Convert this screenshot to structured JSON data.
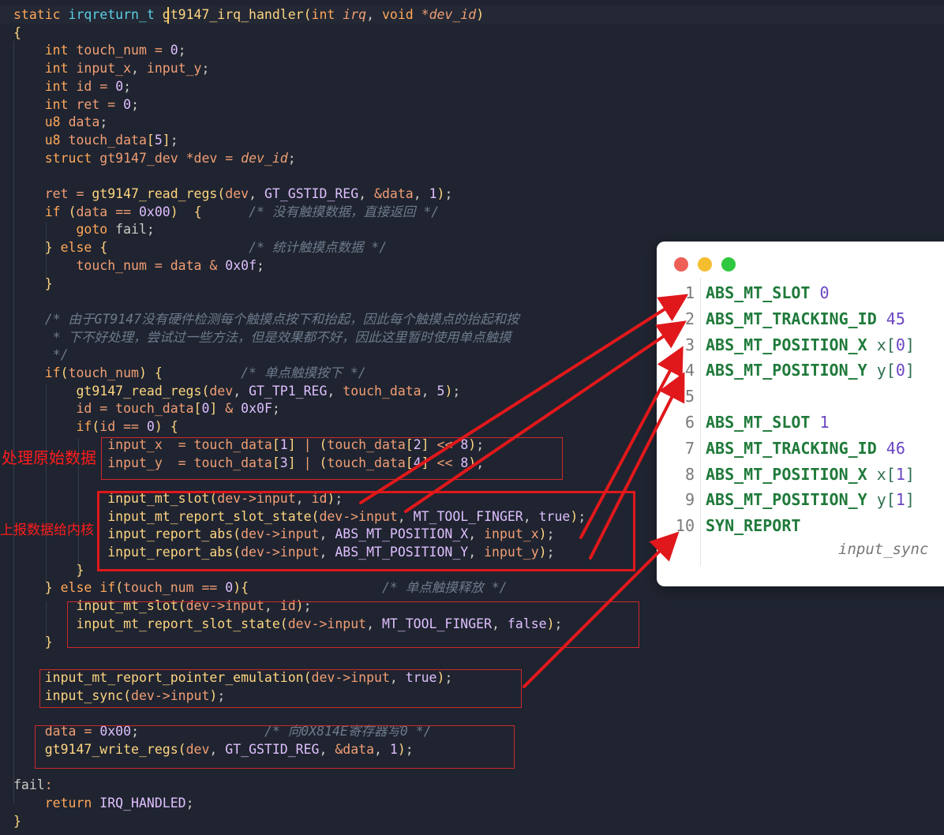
{
  "code": [
    "static irqreturn_t gt9147_irq_handler(int irq, void *dev_id)",
    "{",
    "    int touch_num = 0;",
    "    int input_x, input_y;",
    "    int id = 0;",
    "    int ret = 0;",
    "    u8 data;",
    "    u8 touch_data[5];",
    "    struct gt9147_dev *dev = dev_id;",
    "",
    "    ret = gt9147_read_regs(dev, GT_GSTID_REG, &data, 1);",
    "    if (data == 0x00)  {      /* 没有触摸数据，直接返回 */",
    "        goto fail;",
    "    } else {                  /* 统计触摸点数据 */",
    "        touch_num = data & 0x0f;",
    "    }",
    "",
    "    /* 由于GT9147没有硬件检测每个触摸点按下和抬起，因此每个触摸点的抬起和按",
    "     * 下不好处理，尝试过一些方法，但是效果都不好，因此这里暂时使用单点触摸",
    "     */",
    "    if(touch_num) {          /* 单点触摸按下 */",
    "        gt9147_read_regs(dev, GT_TP1_REG, touch_data, 5);",
    "        id = touch_data[0] & 0x0F;",
    "        if(id == 0) {",
    "            input_x  = touch_data[1] | (touch_data[2] << 8);",
    "            input_y  = touch_data[3] | (touch_data[4] << 8);",
    "",
    "            input_mt_slot(dev->input, id);",
    "            input_mt_report_slot_state(dev->input, MT_TOOL_FINGER, true);",
    "            input_report_abs(dev->input, ABS_MT_POSITION_X, input_x);",
    "            input_report_abs(dev->input, ABS_MT_POSITION_Y, input_y);",
    "        }",
    "    } else if(touch_num == 0){                 /* 单点触摸释放 */",
    "        input_mt_slot(dev->input, id);",
    "        input_mt_report_slot_state(dev->input, MT_TOOL_FINGER, false);",
    "    }",
    "",
    "    input_mt_report_pointer_emulation(dev->input, true);",
    "    input_sync(dev->input);",
    "",
    "    data = 0x00;                /* 向0X814E寄存器写0 */",
    "    gt9147_write_regs(dev, GT_GSTID_REG, &data, 1);",
    "",
    "fail:",
    "    return IRQ_HANDLED;",
    "}"
  ],
  "annotations": {
    "raw_data": "处理原始数据",
    "report_kernel": "上报数据给内核"
  },
  "card": {
    "lines": [
      {
        "no": "1",
        "text": "ABS_MT_SLOT 0"
      },
      {
        "no": "2",
        "text": "ABS_MT_TRACKING_ID 45"
      },
      {
        "no": "3",
        "text": "ABS_MT_POSITION_X x[0]"
      },
      {
        "no": "4",
        "text": "ABS_MT_POSITION_Y y[0]"
      },
      {
        "no": "5",
        "text": ""
      },
      {
        "no": "6",
        "text": "ABS_MT_SLOT 1"
      },
      {
        "no": "7",
        "text": "ABS_MT_TRACKING_ID 46"
      },
      {
        "no": "8",
        "text": "ABS_MT_POSITION_X x[1]"
      },
      {
        "no": "9",
        "text": "ABS_MT_POSITION_Y y[1]"
      },
      {
        "no": "10",
        "text": "SYN_REPORT"
      }
    ],
    "caption": "input_sync"
  },
  "colors": {
    "editor_bg": "#1f2430",
    "annotation_red": "#e0181b",
    "card_bg": "#ffffff",
    "dot_red": "#ed5f57",
    "dot_yellow": "#f5bd30",
    "dot_green": "#2fc840"
  }
}
